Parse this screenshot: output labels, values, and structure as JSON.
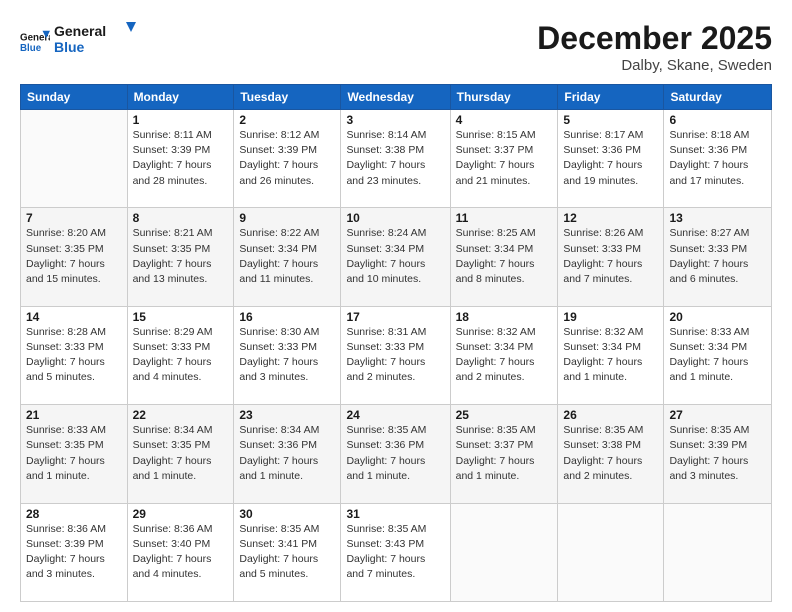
{
  "logo": {
    "line1": "General",
    "line2": "Blue"
  },
  "title": "December 2025",
  "subtitle": "Dalby, Skane, Sweden",
  "weekdays": [
    "Sunday",
    "Monday",
    "Tuesday",
    "Wednesday",
    "Thursday",
    "Friday",
    "Saturday"
  ],
  "weeks": [
    [
      {
        "num": "",
        "info": ""
      },
      {
        "num": "1",
        "info": "Sunrise: 8:11 AM\nSunset: 3:39 PM\nDaylight: 7 hours\nand 28 minutes."
      },
      {
        "num": "2",
        "info": "Sunrise: 8:12 AM\nSunset: 3:39 PM\nDaylight: 7 hours\nand 26 minutes."
      },
      {
        "num": "3",
        "info": "Sunrise: 8:14 AM\nSunset: 3:38 PM\nDaylight: 7 hours\nand 23 minutes."
      },
      {
        "num": "4",
        "info": "Sunrise: 8:15 AM\nSunset: 3:37 PM\nDaylight: 7 hours\nand 21 minutes."
      },
      {
        "num": "5",
        "info": "Sunrise: 8:17 AM\nSunset: 3:36 PM\nDaylight: 7 hours\nand 19 minutes."
      },
      {
        "num": "6",
        "info": "Sunrise: 8:18 AM\nSunset: 3:36 PM\nDaylight: 7 hours\nand 17 minutes."
      }
    ],
    [
      {
        "num": "7",
        "info": "Sunrise: 8:20 AM\nSunset: 3:35 PM\nDaylight: 7 hours\nand 15 minutes."
      },
      {
        "num": "8",
        "info": "Sunrise: 8:21 AM\nSunset: 3:35 PM\nDaylight: 7 hours\nand 13 minutes."
      },
      {
        "num": "9",
        "info": "Sunrise: 8:22 AM\nSunset: 3:34 PM\nDaylight: 7 hours\nand 11 minutes."
      },
      {
        "num": "10",
        "info": "Sunrise: 8:24 AM\nSunset: 3:34 PM\nDaylight: 7 hours\nand 10 minutes."
      },
      {
        "num": "11",
        "info": "Sunrise: 8:25 AM\nSunset: 3:34 PM\nDaylight: 7 hours\nand 8 minutes."
      },
      {
        "num": "12",
        "info": "Sunrise: 8:26 AM\nSunset: 3:33 PM\nDaylight: 7 hours\nand 7 minutes."
      },
      {
        "num": "13",
        "info": "Sunrise: 8:27 AM\nSunset: 3:33 PM\nDaylight: 7 hours\nand 6 minutes."
      }
    ],
    [
      {
        "num": "14",
        "info": "Sunrise: 8:28 AM\nSunset: 3:33 PM\nDaylight: 7 hours\nand 5 minutes."
      },
      {
        "num": "15",
        "info": "Sunrise: 8:29 AM\nSunset: 3:33 PM\nDaylight: 7 hours\nand 4 minutes."
      },
      {
        "num": "16",
        "info": "Sunrise: 8:30 AM\nSunset: 3:33 PM\nDaylight: 7 hours\nand 3 minutes."
      },
      {
        "num": "17",
        "info": "Sunrise: 8:31 AM\nSunset: 3:33 PM\nDaylight: 7 hours\nand 2 minutes."
      },
      {
        "num": "18",
        "info": "Sunrise: 8:32 AM\nSunset: 3:34 PM\nDaylight: 7 hours\nand 2 minutes."
      },
      {
        "num": "19",
        "info": "Sunrise: 8:32 AM\nSunset: 3:34 PM\nDaylight: 7 hours\nand 1 minute."
      },
      {
        "num": "20",
        "info": "Sunrise: 8:33 AM\nSunset: 3:34 PM\nDaylight: 7 hours\nand 1 minute."
      }
    ],
    [
      {
        "num": "21",
        "info": "Sunrise: 8:33 AM\nSunset: 3:35 PM\nDaylight: 7 hours\nand 1 minute."
      },
      {
        "num": "22",
        "info": "Sunrise: 8:34 AM\nSunset: 3:35 PM\nDaylight: 7 hours\nand 1 minute."
      },
      {
        "num": "23",
        "info": "Sunrise: 8:34 AM\nSunset: 3:36 PM\nDaylight: 7 hours\nand 1 minute."
      },
      {
        "num": "24",
        "info": "Sunrise: 8:35 AM\nSunset: 3:36 PM\nDaylight: 7 hours\nand 1 minute."
      },
      {
        "num": "25",
        "info": "Sunrise: 8:35 AM\nSunset: 3:37 PM\nDaylight: 7 hours\nand 1 minute."
      },
      {
        "num": "26",
        "info": "Sunrise: 8:35 AM\nSunset: 3:38 PM\nDaylight: 7 hours\nand 2 minutes."
      },
      {
        "num": "27",
        "info": "Sunrise: 8:35 AM\nSunset: 3:39 PM\nDaylight: 7 hours\nand 3 minutes."
      }
    ],
    [
      {
        "num": "28",
        "info": "Sunrise: 8:36 AM\nSunset: 3:39 PM\nDaylight: 7 hours\nand 3 minutes."
      },
      {
        "num": "29",
        "info": "Sunrise: 8:36 AM\nSunset: 3:40 PM\nDaylight: 7 hours\nand 4 minutes."
      },
      {
        "num": "30",
        "info": "Sunrise: 8:35 AM\nSunset: 3:41 PM\nDaylight: 7 hours\nand 5 minutes."
      },
      {
        "num": "31",
        "info": "Sunrise: 8:35 AM\nSunset: 3:43 PM\nDaylight: 7 hours\nand 7 minutes."
      },
      {
        "num": "",
        "info": ""
      },
      {
        "num": "",
        "info": ""
      },
      {
        "num": "",
        "info": ""
      }
    ]
  ]
}
